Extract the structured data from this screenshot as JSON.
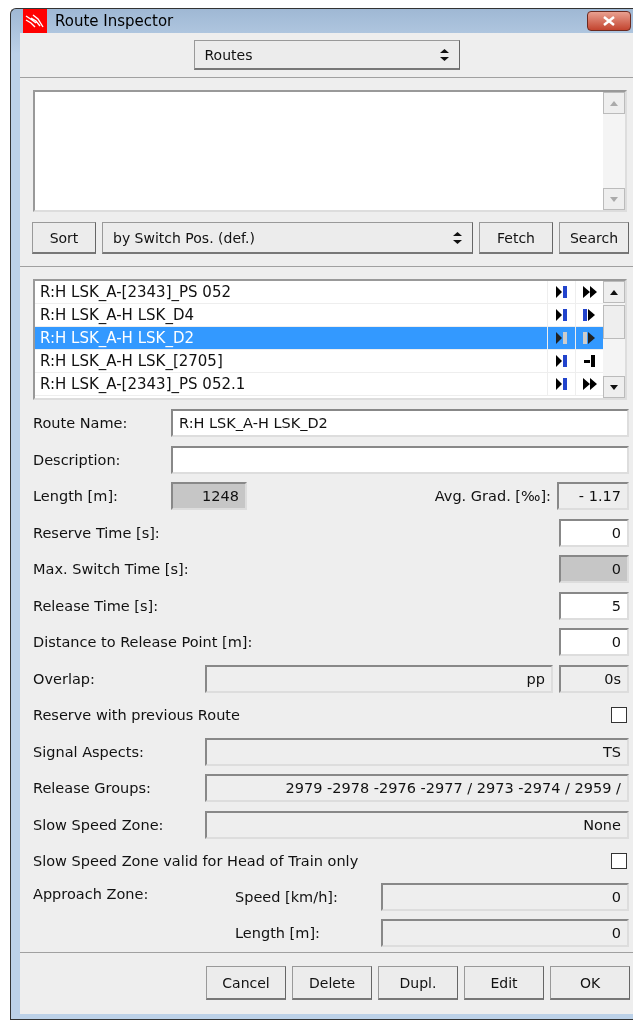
{
  "window": {
    "title": "Route Inspector"
  },
  "view_select": {
    "value": "Routes"
  },
  "sort_bar": {
    "sort_button": "Sort",
    "sort_by": "by Switch Pos. (def.)",
    "buttons": [
      "Fetch",
      "Search"
    ]
  },
  "routes": [
    {
      "name": "R:H LSK_A-[2343]_PS 052",
      "selected": false,
      "icons": [
        {
          "kind": "bar"
        },
        {
          "kind": "double"
        }
      ]
    },
    {
      "name": "R:H LSK_A-H LSK_D4",
      "selected": false,
      "icons": [
        {
          "kind": "bar"
        },
        {
          "kind": "bar_arrow"
        }
      ]
    },
    {
      "name": "R:H LSK_A-H LSK_D2",
      "selected": true,
      "icons": [
        {
          "kind": "bar"
        },
        {
          "kind": "bar_arrow"
        }
      ]
    },
    {
      "name": "R:H LSK_A-H LSK_[2705]",
      "selected": false,
      "icons": [
        {
          "kind": "bar"
        },
        {
          "kind": "stop"
        }
      ]
    },
    {
      "name": "R:H LSK_A-[2343]_PS 052.1",
      "selected": false,
      "icons": [
        {
          "kind": "bar"
        },
        {
          "kind": "double"
        }
      ]
    }
  ],
  "fields": [
    {
      "kind": "input",
      "label": "Route Name:",
      "value": "R:H LSK_A-H LSK_D2"
    },
    {
      "kind": "input",
      "label": "Description:"
    },
    {
      "kind": "pair",
      "label": "Length [m]:",
      "value": "1248",
      "disabled": true,
      "label2": "Avg. Grad. [‰]:",
      "value2": "-  1.17"
    },
    {
      "kind": "number",
      "label": "Reserve Time [s]:",
      "value": "0",
      "disabled": false
    },
    {
      "kind": "number",
      "label": "Max. Switch Time [s]:",
      "value": "0",
      "disabled": true
    },
    {
      "kind": "number",
      "label": "Release Time [s]:",
      "value": "5",
      "disabled": false
    },
    {
      "kind": "number",
      "label": "Distance to Release Point [m]:",
      "value": "0",
      "disabled": false
    },
    {
      "kind": "readout2",
      "label": "Overlap:",
      "value": "pp",
      "value2": "0s"
    },
    {
      "kind": "checkbox",
      "label": "Reserve with previous Route",
      "checked": false
    },
    {
      "kind": "readout",
      "label": "Signal Aspects:",
      "value": "TS"
    },
    {
      "kind": "readout",
      "label": "Release Groups:",
      "value": "2979 -2978 -2976 -2977  / 2973 -2974  / 2959  /"
    },
    {
      "kind": "readout",
      "label": "Slow Speed Zone:",
      "value": "None"
    },
    {
      "kind": "checkbox",
      "label": "Slow Speed Zone valid for Head of Train only",
      "checked": false
    },
    {
      "kind": "approach",
      "label": "Approach Zone:",
      "parts": [
        {
          "label": "Speed [km/h]:",
          "value": "0"
        },
        {
          "label": "Length [m]:",
          "value": "0"
        }
      ]
    }
  ],
  "buttons": [
    "Cancel",
    "Delete",
    "Dupl.",
    "Edit",
    "OK"
  ]
}
